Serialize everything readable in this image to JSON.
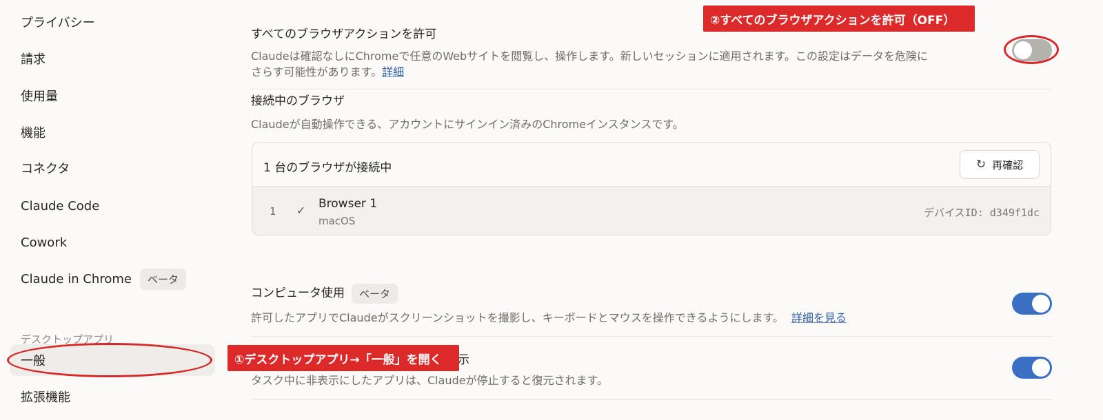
{
  "sidebar": {
    "items": [
      {
        "label": "プライバシー"
      },
      {
        "label": "請求"
      },
      {
        "label": "使用量"
      },
      {
        "label": "機能"
      },
      {
        "label": "コネクタ"
      },
      {
        "label": "Claude Code"
      },
      {
        "label": "Cowork"
      },
      {
        "label": "Claude in Chrome",
        "badge": "ベータ"
      }
    ],
    "section_label": "デスクトップアプリ",
    "desktop_items": [
      {
        "label": "一般",
        "active": true
      },
      {
        "label": "拡張機能"
      }
    ]
  },
  "main": {
    "allow_all": {
      "title": "すべてのブラウザアクションを許可",
      "desc_line1": "Claudeは確認なしにChromeで任意のWebサイトを閲覧し、操作します。新しいセッションに適用されます。この設定はデータを危険に",
      "desc_line2": "さらす可能性があります。",
      "link": "詳細",
      "toggle_on": false
    },
    "connected": {
      "title": "接続中のブラウザ",
      "desc": "Claudeが自動操作できる、アカウントにサインイン済みのChromeインスタンスです。",
      "count_label": "1 台のブラウザが接続中",
      "recheck_label": "再確認",
      "browsers": [
        {
          "index": "1",
          "name": "Browser 1",
          "os": "macOS",
          "device_id": "デバイスID: d349f1dc"
        }
      ]
    },
    "computer_use": {
      "title": "コンピュータ使用",
      "badge": "ベータ",
      "desc": "許可したアプリでClaudeがスクリーンショットを撮影し、キーボードとマウスを操作できるようにします。",
      "link": "詳細を見る",
      "toggle_on": true
    },
    "hide_apps": {
      "title_visible": "示",
      "desc": "タスク中に非表示にしたアプリは、Claudeが停止すると復元されます。",
      "toggle_on": true
    }
  },
  "annotations": {
    "callout_1": "①デスクトップアプリ→「一般」を開く",
    "callout_2": "②すべてのブラウザアクションを許可（OFF）",
    "color": "#dc2a2b"
  },
  "colors": {
    "toggle_on": "#3a6fc4",
    "toggle_off": "#b3b2ad",
    "link": "#2c5aa0",
    "background": "#fbfaf8"
  }
}
